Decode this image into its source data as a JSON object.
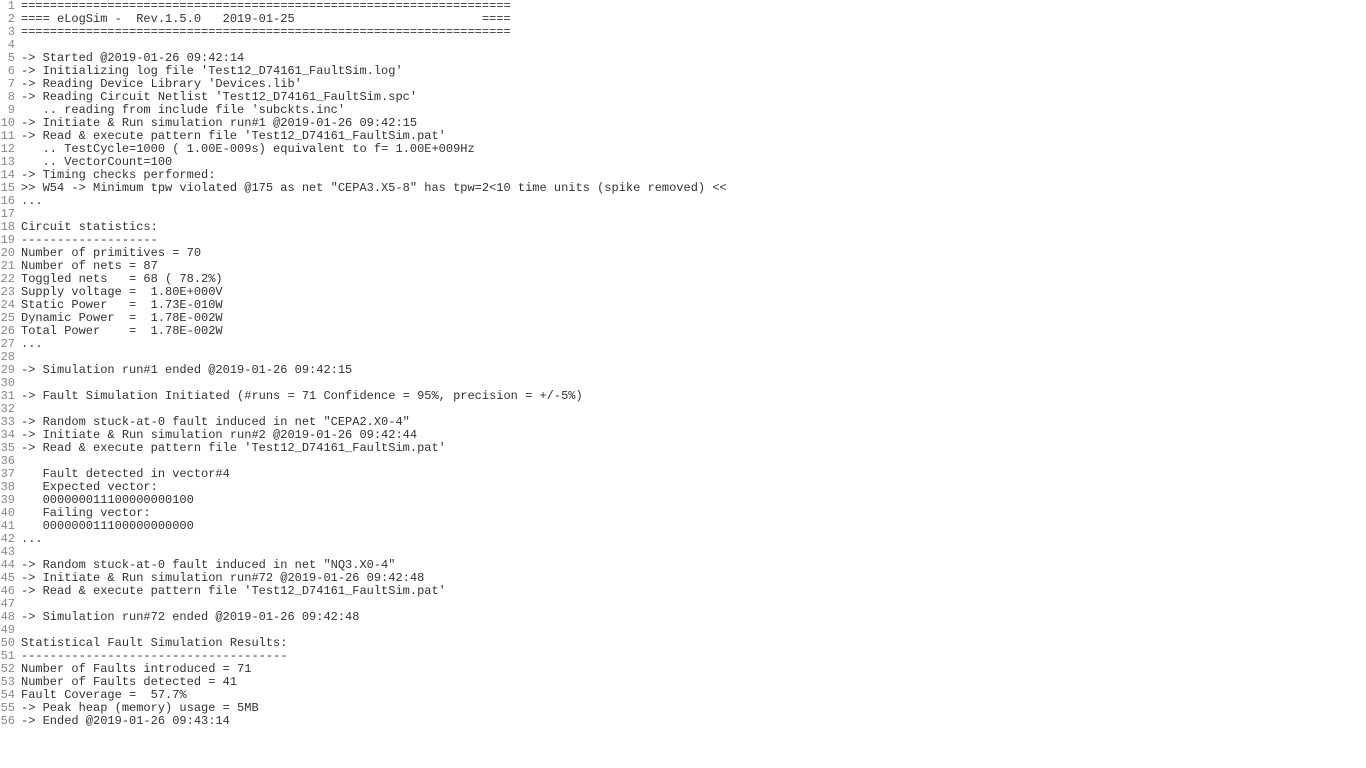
{
  "lines": [
    "====================================================================",
    "==== eLogSim -  Rev.1.5.0   2019-01-25                          ====",
    "====================================================================",
    "",
    "-> Started @2019-01-26 09:42:14",
    "-> Initializing log file 'Test12_D74161_FaultSim.log'",
    "-> Reading Device Library 'Devices.lib'",
    "-> Reading Circuit Netlist 'Test12_D74161_FaultSim.spc'",
    "   .. reading from include file 'subckts.inc'",
    "-> Initiate & Run simulation run#1 @2019-01-26 09:42:15",
    "-> Read & execute pattern file 'Test12_D74161_FaultSim.pat'",
    "   .. TestCycle=1000 ( 1.00E-009s) equivalent to f= 1.00E+009Hz",
    "   .. VectorCount=100",
    "-> Timing checks performed:",
    ">> W54 -> Minimum tpw violated @175 as net \"CEPA3.X5-8\" has tpw=2<10 time units (spike removed) <<",
    "...",
    "",
    "Circuit statistics:",
    "-------------------",
    "Number of primitives = 70",
    "Number of nets = 87",
    "Toggled nets   = 68 ( 78.2%)",
    "Supply voltage =  1.80E+000V",
    "Static Power   =  1.73E-010W",
    "Dynamic Power  =  1.78E-002W",
    "Total Power    =  1.78E-002W",
    "...",
    "",
    "-> Simulation run#1 ended @2019-01-26 09:42:15",
    "",
    "-> Fault Simulation Initiated (#runs = 71 Confidence = 95%, precision = +/-5%)",
    "",
    "-> Random stuck-at-0 fault induced in net \"CEPA2.X0-4\"",
    "-> Initiate & Run simulation run#2 @2019-01-26 09:42:44",
    "-> Read & execute pattern file 'Test12_D74161_FaultSim.pat'",
    "",
    "   Fault detected in vector#4",
    "   Expected vector:",
    "   000000011100000000100",
    "   Failing vector:",
    "   000000011100000000000",
    "...",
    "",
    "-> Random stuck-at-0 fault induced in net \"NQ3.X0-4\"",
    "-> Initiate & Run simulation run#72 @2019-01-26 09:42:48",
    "-> Read & execute pattern file 'Test12_D74161_FaultSim.pat'",
    "",
    "-> Simulation run#72 ended @2019-01-26 09:42:48",
    "",
    "Statistical Fault Simulation Results:",
    "-------------------------------------",
    "Number of Faults introduced = 71",
    "Number of Faults detected = 41",
    "Fault Coverage =  57.7%",
    "-> Peak heap (memory) usage = 5MB",
    "-> Ended @2019-01-26 09:43:14"
  ]
}
